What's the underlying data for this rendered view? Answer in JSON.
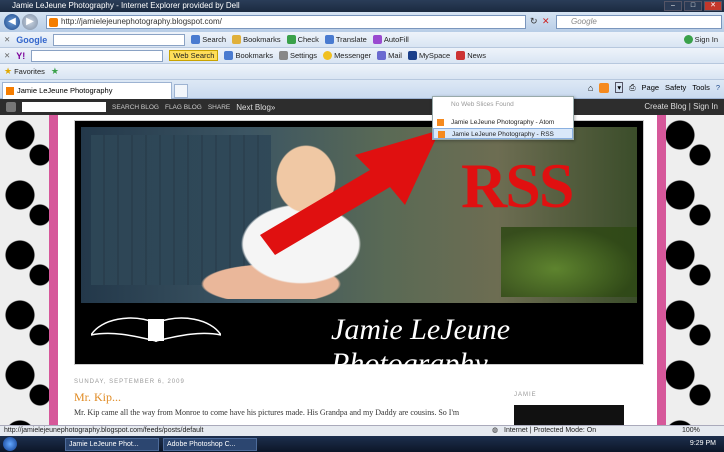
{
  "window": {
    "title": "Jamie LeJeune Photography - Internet Explorer provided by Dell"
  },
  "address_bar": {
    "url": "http://jamielejeunephotography.blogspot.com/",
    "search_placeholder": "Google"
  },
  "google_toolbar": {
    "logo": "Google",
    "items": [
      "Search",
      "Bookmarks",
      "Check",
      "Translate",
      "AutoFill",
      "Sign In"
    ]
  },
  "yahoo_toolbar": {
    "logo": "Y!",
    "web_search": "Web Search",
    "items": [
      "Bookmarks",
      "Settings",
      "Messenger",
      "Mail",
      "MySpace",
      "News"
    ]
  },
  "favorites": {
    "label": "Favorites"
  },
  "tab": {
    "label": "Jamie LeJeune Photography"
  },
  "command_bar": {
    "items": [
      "Page",
      "Safety",
      "Tools"
    ]
  },
  "feed_menu": {
    "items": [
      {
        "label": "No Web Slices Found",
        "disabled": true
      },
      {
        "label": "Jamie LeJeune Photography - Atom",
        "disabled": false
      },
      {
        "label": "Jamie LeJeune Photography - RSS",
        "disabled": false,
        "selected": true
      }
    ]
  },
  "blogger_nav": {
    "search_blog": "SEARCH BLOG",
    "flag_blog": "FLAG BLOG",
    "share": "SHARE",
    "next_blog": "Next Blog»",
    "create_blog": "Create Blog | Sign In"
  },
  "header": {
    "photo_overlay_text": "RSS",
    "blog_title": "Jamie LeJeune Photography"
  },
  "post": {
    "date": "SUNDAY, SEPTEMBER 6, 2009",
    "title": "Mr. Kip...",
    "body": "Mr. Kip came all the way from Monroe to come have his pictures made. His Grandpa and my Daddy are cousins. So I'm"
  },
  "sidebar": {
    "heading": "JAMIE"
  },
  "status_bar": {
    "url": "http://jamielejeunephotography.blogspot.com/feeds/posts/default",
    "zone": "Internet | Protected Mode: On",
    "zoom": "100%"
  },
  "taskbar": {
    "buttons": [
      "Jamie LeJeune Phot...",
      "Adobe Photoshop C..."
    ],
    "clock": "9:29 PM"
  },
  "colors": {
    "accent_pink": "#d6589a",
    "rss_orange": "#f58a1f",
    "arrow_red": "#e01010"
  }
}
